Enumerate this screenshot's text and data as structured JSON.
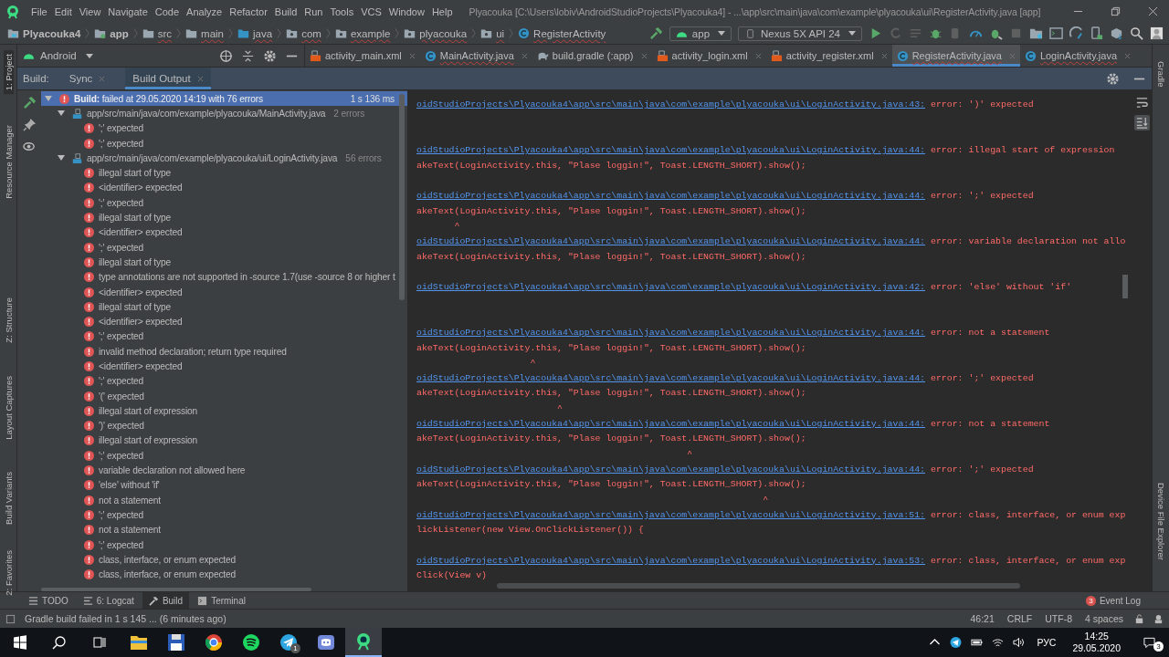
{
  "menu": {
    "items": [
      "File",
      "Edit",
      "View",
      "Navigate",
      "Code",
      "Analyze",
      "Refactor",
      "Build",
      "Run",
      "Tools",
      "VCS",
      "Window",
      "Help"
    ],
    "title": "Plyacouka [C:\\Users\\lobiv\\AndroidStudioProjects\\Plyacouka4] - ...\\app\\src\\main\\java\\com\\example\\plyacouka\\ui\\RegisterActivity.java [app]"
  },
  "breadcrumb": [
    {
      "label": "Plyacouka4",
      "kind": "project"
    },
    {
      "label": "app",
      "kind": "module"
    },
    {
      "label": "src",
      "kind": "folder"
    },
    {
      "label": "main",
      "kind": "folder"
    },
    {
      "label": "java",
      "kind": "source"
    },
    {
      "label": "com",
      "kind": "package"
    },
    {
      "label": "example",
      "kind": "package"
    },
    {
      "label": "plyacouka",
      "kind": "package"
    },
    {
      "label": "ui",
      "kind": "package"
    },
    {
      "label": "RegisterActivity",
      "kind": "class"
    }
  ],
  "run_config": {
    "module": "app",
    "device": "Nexus 5X API 24"
  },
  "project_view": {
    "label": "Android"
  },
  "editor_tabs": [
    {
      "label": "activity_main.xml",
      "kind": "xml",
      "selected": false
    },
    {
      "label": "MainActivity.java",
      "kind": "java",
      "selected": false
    },
    {
      "label": "build.gradle (:app)",
      "kind": "gradle",
      "selected": false
    },
    {
      "label": "activity_login.xml",
      "kind": "xml",
      "selected": false
    },
    {
      "label": "activity_register.xml",
      "kind": "xml",
      "selected": false
    },
    {
      "label": "RegisterActivity.java",
      "kind": "java",
      "selected": true
    },
    {
      "label": "LoginActivity.java",
      "kind": "java",
      "selected": false
    }
  ],
  "left_strip": [
    {
      "label": "1: Project",
      "selected": true
    },
    {
      "label": "Resource Manager",
      "selected": false
    },
    {
      "label": "Z: Structure",
      "selected": false
    },
    {
      "label": "Layout Captures",
      "selected": false
    },
    {
      "label": "Build Variants",
      "selected": false
    },
    {
      "label": "2: Favorites",
      "selected": false
    }
  ],
  "right_strip": [
    {
      "label": "Gradle",
      "selected": false
    },
    {
      "label": "Device File Explorer",
      "selected": false
    }
  ],
  "build_panel": {
    "title": "Build:",
    "tabs": [
      {
        "label": "Sync",
        "selected": false
      },
      {
        "label": "Build Output",
        "selected": true
      }
    ]
  },
  "build_tree": {
    "label": "**Build:** failed at 29.05.2020 14:19 with 76 errors",
    "time": "1 s 136 ms",
    "expanded": true,
    "selected": true,
    "children": [
      {
        "path": "app/src/main/java/com/example/plyacouka/MainActivity.java",
        "count": "2 errors",
        "expanded": true,
        "selected": false,
        "children": [
          {
            "label": "';' expected",
            "selected": false
          },
          {
            "label": "';' expected",
            "selected": false
          }
        ]
      },
      {
        "path": "app/src/main/java/com/example/plyacouka/ui/LoginActivity.java",
        "count": "56 errors",
        "expanded": true,
        "selected": false,
        "children": [
          {
            "label": "illegal start of type",
            "selected": false
          },
          {
            "label": "<identifier> expected",
            "selected": false
          },
          {
            "label": "';' expected",
            "selected": false
          },
          {
            "label": "illegal start of type",
            "selected": false
          },
          {
            "label": "<identifier> expected",
            "selected": false
          },
          {
            "label": "';' expected",
            "selected": false
          },
          {
            "label": "illegal start of type",
            "selected": false
          },
          {
            "label": "type annotations are not supported in -source 1.7(use -source 8 or higher t",
            "selected": false
          },
          {
            "label": "<identifier> expected",
            "selected": false
          },
          {
            "label": "illegal start of type",
            "selected": false
          },
          {
            "label": "<identifier> expected",
            "selected": false
          },
          {
            "label": "';' expected",
            "selected": false
          },
          {
            "label": "invalid method declaration; return type required",
            "selected": false
          },
          {
            "label": "<identifier> expected",
            "selected": false
          },
          {
            "label": "';' expected",
            "selected": false
          },
          {
            "label": "'(' expected",
            "selected": false
          },
          {
            "label": "illegal start of expression",
            "selected": false
          },
          {
            "label": "')' expected",
            "selected": false
          },
          {
            "label": "illegal start of expression",
            "selected": false
          },
          {
            "label": "';' expected",
            "selected": false
          },
          {
            "label": "variable declaration not allowed here",
            "selected": false
          },
          {
            "label": "'else' without 'if'",
            "selected": false
          },
          {
            "label": "not a statement",
            "selected": false
          },
          {
            "label": "';' expected",
            "selected": false
          },
          {
            "label": "not a statement",
            "selected": false
          },
          {
            "label": "';' expected",
            "selected": false
          },
          {
            "label": "class, interface, or enum expected",
            "selected": false
          },
          {
            "label": "class, interface, or enum expected",
            "selected": false
          }
        ]
      }
    ]
  },
  "console": [
    {
      "path": "oidStudioProjects\\Plyacouka4\\app\\src\\main\\java\\com\\example\\plyacouka\\ui\\LoginActivity.java:43:",
      "message": "error: ')' expected"
    },
    {
      "path": "oidStudioProjects\\Plyacouka4\\app\\src\\main\\java\\com\\example\\plyacouka\\ui\\LoginActivity.java:44:",
      "message": "error: illegal start of expression",
      "code": "akeText(LoginActivity.this, \"Plase loggin!\", Toast.LENGTH_SHORT).show();"
    },
    {
      "path": "oidStudioProjects\\Plyacouka4\\app\\src\\main\\java\\com\\example\\plyacouka\\ui\\LoginActivity.java:44:",
      "message": "error: ';' expected",
      "code": "akeText(LoginActivity.this, \"Plase loggin!\", Toast.LENGTH_SHORT).show();",
      "caret": "       ^"
    },
    {
      "path": "oidStudioProjects\\Plyacouka4\\app\\src\\main\\java\\com\\example\\plyacouka\\ui\\LoginActivity.java:44:",
      "message": "error: variable declaration not allo",
      "code": "akeText(LoginActivity.this, \"Plase loggin!\", Toast.LENGTH_SHORT).show();"
    },
    {
      "path": "oidStudioProjects\\Plyacouka4\\app\\src\\main\\java\\com\\example\\plyacouka\\ui\\LoginActivity.java:42:",
      "message": "error: 'else' without 'if'"
    },
    {
      "path": "oidStudioProjects\\Plyacouka4\\app\\src\\main\\java\\com\\example\\plyacouka\\ui\\LoginActivity.java:44:",
      "message": "error: not a statement",
      "code": "akeText(LoginActivity.this, \"Plase loggin!\", Toast.LENGTH_SHORT).show();",
      "caret": "                     ^"
    },
    {
      "path": "oidStudioProjects\\Plyacouka4\\app\\src\\main\\java\\com\\example\\plyacouka\\ui\\LoginActivity.java:44:",
      "message": "error: ';' expected",
      "code": "akeText(LoginActivity.this, \"Plase loggin!\", Toast.LENGTH_SHORT).show();",
      "caret": "                          ^"
    },
    {
      "path": "oidStudioProjects\\Plyacouka4\\app\\src\\main\\java\\com\\example\\plyacouka\\ui\\LoginActivity.java:44:",
      "message": "error: not a statement",
      "code": "akeText(LoginActivity.this, \"Plase loggin!\", Toast.LENGTH_SHORT).show();",
      "caret": "                                                  ^"
    },
    {
      "path": "oidStudioProjects\\Plyacouka4\\app\\src\\main\\java\\com\\example\\plyacouka\\ui\\LoginActivity.java:44:",
      "message": "error: ';' expected",
      "code": "akeText(LoginActivity.this, \"Plase loggin!\", Toast.LENGTH_SHORT).show();",
      "caret": "                                                                ^"
    },
    {
      "path": "oidStudioProjects\\Plyacouka4\\app\\src\\main\\java\\com\\example\\plyacouka\\ui\\LoginActivity.java:51:",
      "message": "error: class, interface, or enum exp",
      "code": "lickListener(new View.OnClickListener()) {"
    },
    {
      "path": "oidStudioProjects\\Plyacouka4\\app\\src\\main\\java\\com\\example\\plyacouka\\ui\\LoginActivity.java:53:",
      "message": "error: class, interface, or enum exp",
      "code": "Click(View v)"
    }
  ],
  "bottom_tabs": [
    {
      "label": "TODO",
      "kind": "list",
      "selected": false
    },
    {
      "label": "6: Logcat",
      "kind": "logcat",
      "selected": false
    },
    {
      "label": "Build",
      "kind": "hammer",
      "selected": true
    },
    {
      "label": "Terminal",
      "kind": "terminal",
      "selected": false
    }
  ],
  "event_log": {
    "label": "Event Log",
    "badge": "3"
  },
  "status_bar": {
    "message": "Gradle build failed in 1 s 145 ... (6 minutes ago)",
    "position": "46:21",
    "line_separator": "CRLF",
    "encoding": "UTF-8",
    "indent": "4 spaces"
  },
  "taskbar": {
    "apps": [
      {
        "kind": "folder",
        "active": false
      },
      {
        "kind": "floppy",
        "active": false
      },
      {
        "kind": "browser",
        "active": false
      },
      {
        "kind": "music",
        "active": false
      },
      {
        "kind": "plane",
        "active": false,
        "badge": "1"
      },
      {
        "kind": "controller",
        "active": false
      },
      {
        "kind": "robot",
        "active": true
      }
    ],
    "language": "РУС",
    "time": "14:25",
    "date": "29.05.2020",
    "notifications": "3"
  }
}
